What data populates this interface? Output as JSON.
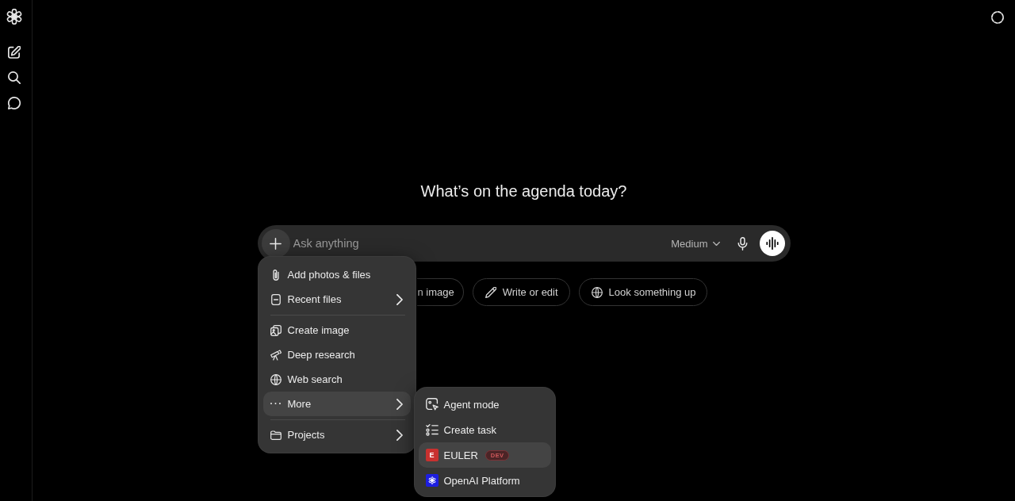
{
  "heading": "What’s on the agenda today?",
  "composer": {
    "placeholder": "Ask anything",
    "model": "Medium",
    "menu_open": true
  },
  "suggestions": [
    {
      "kind": "clipped",
      "label": "n image"
    },
    {
      "kind": "chip",
      "label": "Write or edit"
    },
    {
      "kind": "chip",
      "label": "Look something up"
    }
  ],
  "menu": {
    "sections": [
      {
        "items": [
          {
            "label": "Add photos & files",
            "submenu": false,
            "selected": false
          },
          {
            "label": "Recent files",
            "submenu": true,
            "selected": false
          }
        ]
      },
      {
        "items": [
          {
            "label": "Create image",
            "submenu": false,
            "selected": false
          },
          {
            "label": "Deep research",
            "submenu": false,
            "selected": false
          },
          {
            "label": "Web search",
            "submenu": false,
            "selected": false
          },
          {
            "label": "More",
            "submenu": true,
            "selected": true
          }
        ]
      },
      {
        "items": [
          {
            "label": "Projects",
            "submenu": true,
            "selected": false
          }
        ]
      }
    ]
  },
  "submenu": {
    "items": [
      {
        "kind": "action",
        "label": "Agent mode",
        "selected": false
      },
      {
        "kind": "action",
        "label": "Create task",
        "selected": false
      },
      {
        "kind": "app",
        "label": "EULER",
        "letter": "E",
        "badge": "DEV",
        "color": "#c8312f",
        "selected": true
      },
      {
        "kind": "app",
        "label": "OpenAI Platform",
        "color": "#1d1ee0",
        "selected": false
      }
    ]
  }
}
